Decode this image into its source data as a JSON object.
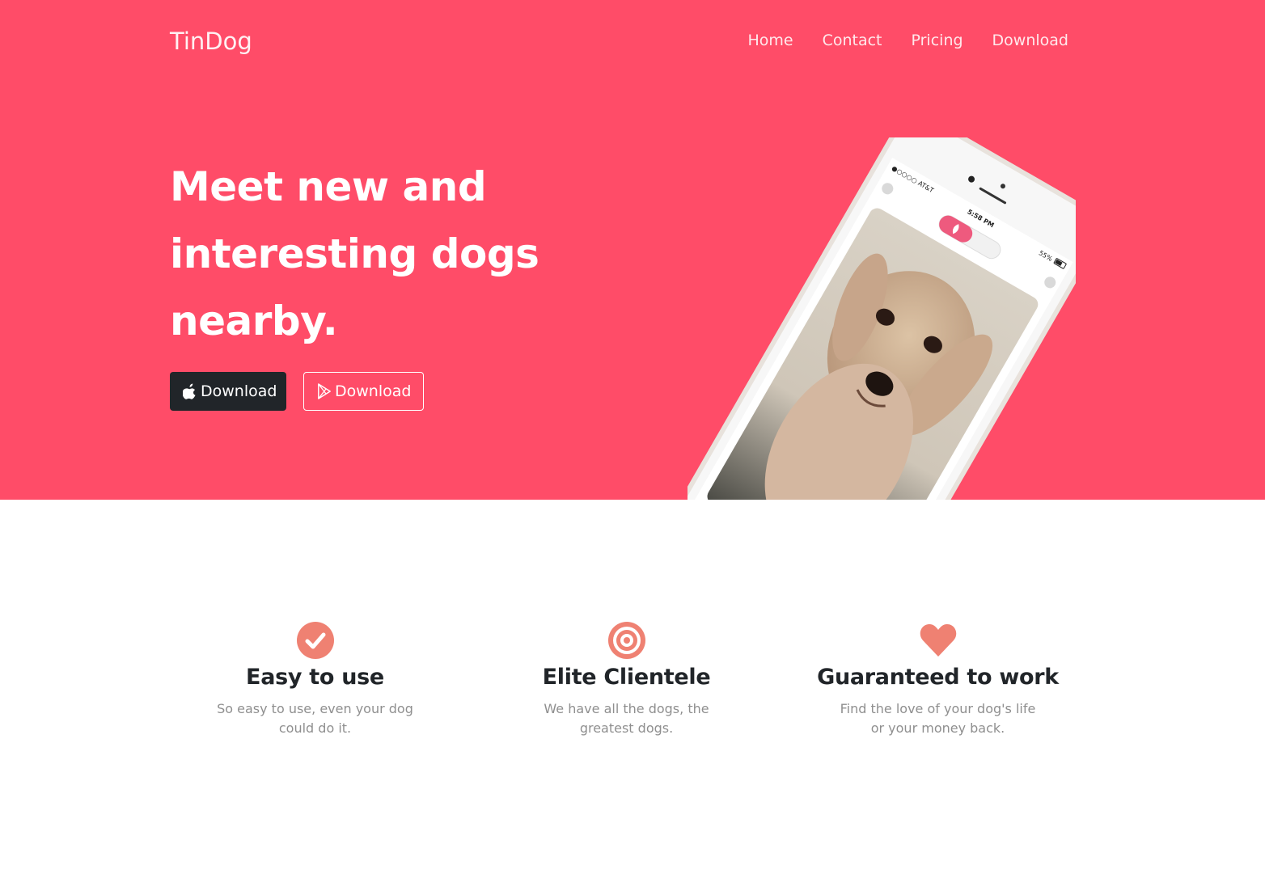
{
  "navbar": {
    "brand": "TinDog",
    "links": [
      "Home",
      "Contact",
      "Pricing",
      "Download"
    ]
  },
  "hero": {
    "title": "Meet new and interesting dogs nearby.",
    "buttons": [
      {
        "label": "Download",
        "icon": "apple-icon"
      },
      {
        "label": "Download",
        "icon": "google-play-icon"
      }
    ],
    "phone": {
      "carrier": "●○○○○ AT&T",
      "time": "5:58 PM",
      "battery": "55%"
    }
  },
  "features": [
    {
      "icon": "check-circle-icon",
      "title": "Easy to use",
      "text": "So easy to use, even your dog could do it."
    },
    {
      "icon": "bullseye-icon",
      "title": "Elite Clientele",
      "text": "We have all the dogs, the greatest dogs."
    },
    {
      "icon": "heart-icon",
      "title": "Guaranteed to work",
      "text": "Find the love of your dog's life or your money back."
    }
  ],
  "colors": {
    "hero_bg": "#ff4c68",
    "dark_button": "#212529",
    "icon_accent": "#ef8172",
    "heading": "#212529",
    "muted_text": "#8f8f8f"
  }
}
